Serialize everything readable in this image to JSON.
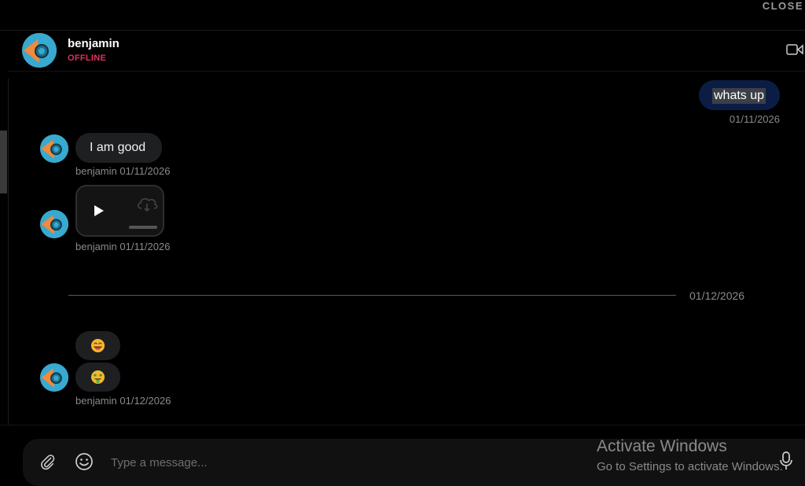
{
  "window": {
    "close_label": "CLOSE"
  },
  "contact": {
    "name": "benjamin",
    "status": "OFFLINE",
    "status_color": "#e0325b"
  },
  "header": {
    "video_call_icon": "video-camera-icon"
  },
  "messages": {
    "outgoing": {
      "text": "whats up",
      "timestamp": "01/11/2026"
    },
    "incoming_text": {
      "text": "I am good",
      "meta": "benjamin 01/11/2026"
    },
    "incoming_video": {
      "play_icon": "play-icon",
      "download_icon": "cloud-download-icon",
      "meta": "benjamin 01/11/2026"
    },
    "date_divider": "01/12/2026",
    "incoming_emojis": {
      "emoji_1": "laughing-face-emoji",
      "emoji_2": "money-mouth-face-emoji",
      "meta": "benjamin 01/12/2026"
    }
  },
  "composer": {
    "placeholder": "Type a message...",
    "attach_icon": "paperclip-icon",
    "emoji_icon": "smiley-icon",
    "mic_icon": "microphone-icon"
  },
  "watermark": {
    "title": "Activate Windows",
    "subtitle": "Go to Settings to activate Windows."
  },
  "colors": {
    "background": "#000000",
    "outgoing_bubble": "#0c1d45",
    "incoming_bubble": "#1e1f21",
    "avatar_bg": "#38a9cf",
    "avatar_accent": "#f08a3c"
  }
}
